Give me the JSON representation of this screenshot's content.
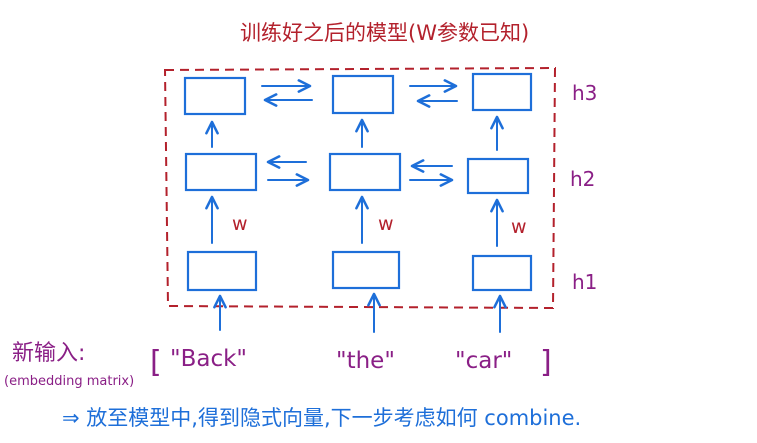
{
  "title": "训练好之后的模型(W参数已知)",
  "layers": [
    "h3",
    "h2",
    "h1"
  ],
  "weight_label": "w",
  "input_label": "新输入:",
  "input_sublabel": "(embedding matrix)",
  "tokens_open": "[",
  "tokens": [
    "\"Back\"",
    "\"the\"",
    "\"car\""
  ],
  "tokens_close": "]",
  "conclusion": "⇒ 放至模型中,得到隐式向量,下一步考虑如何 combine."
}
